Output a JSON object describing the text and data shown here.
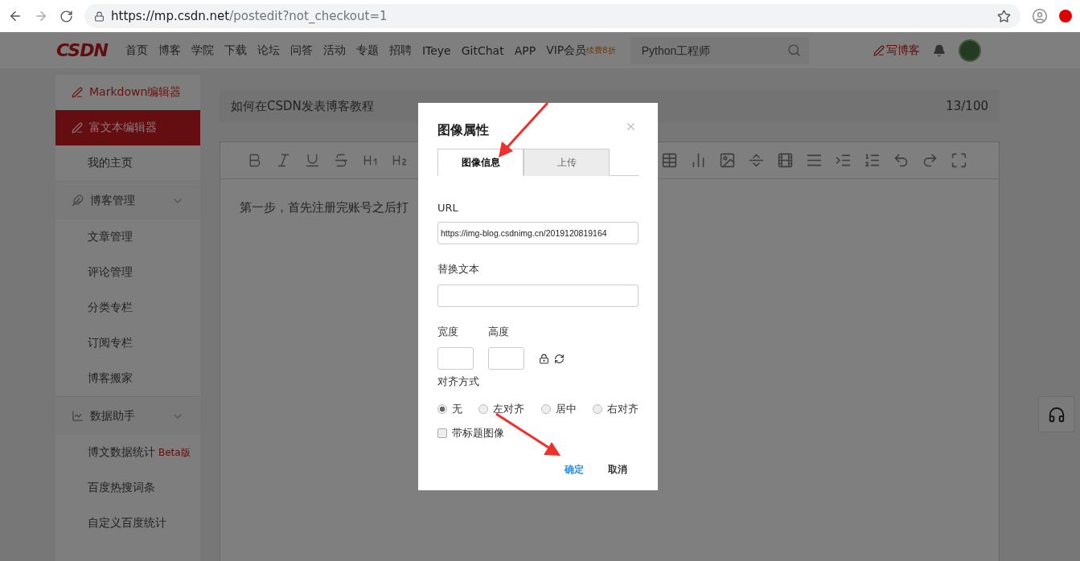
{
  "browser": {
    "url_host": "https://mp.csdn.net",
    "url_path": "/postedit?not_checkout=1"
  },
  "navbar": {
    "logo": "CSDN",
    "links": [
      "首页",
      "博客",
      "学院",
      "下载",
      "论坛",
      "问答",
      "活动",
      "专题",
      "招聘",
      "ITeye",
      "GitChat",
      "APP"
    ],
    "vip": {
      "label": "VIP会员",
      "badge": "续费8折"
    },
    "search": {
      "placeholder": "Python工程师"
    },
    "write_label": "写博客"
  },
  "sidebar": [
    {
      "kind": "editor",
      "label": "Markdown编辑器",
      "selected": false
    },
    {
      "kind": "editor",
      "label": "富文本编辑器",
      "selected": true
    },
    {
      "kind": "link",
      "label": "我的主页"
    },
    {
      "kind": "group",
      "label": "博客管理",
      "expanded": true,
      "children": [
        {
          "label": "文章管理"
        },
        {
          "label": "评论管理"
        },
        {
          "label": "分类专栏"
        },
        {
          "label": "订阅专栏"
        },
        {
          "label": "博客搬家"
        }
      ]
    },
    {
      "kind": "group",
      "label": "数据助手",
      "expanded": true,
      "children": [
        {
          "label": "博文数据统计",
          "badge": "Beta版"
        },
        {
          "label": "百度热搜词条"
        },
        {
          "label": "自定义百度统计"
        }
      ]
    }
  ],
  "editor": {
    "title": "如何在CSDN发表博客教程",
    "counter": "13/100",
    "body": "第一步，首先注册完账号之后打"
  },
  "dialog": {
    "title": "图像属性",
    "tabs": [
      {
        "label": "图像信息",
        "selected": true
      },
      {
        "label": "上传",
        "selected": false
      }
    ],
    "url_label": "URL",
    "url_value": "https://img-blog.csdnimg.cn/2019120819164",
    "alt_label": "替换文本",
    "width_label": "宽度",
    "height_label": "高度",
    "align_label": "对齐方式",
    "align_options": [
      {
        "label": "无",
        "selected": true
      },
      {
        "label": "左对齐",
        "selected": false
      },
      {
        "label": "居中",
        "selected": false
      },
      {
        "label": "右对齐",
        "selected": false
      }
    ],
    "caption": {
      "label": "带标题图像",
      "checked": false
    },
    "ok": "确定",
    "cancel": "取消"
  }
}
